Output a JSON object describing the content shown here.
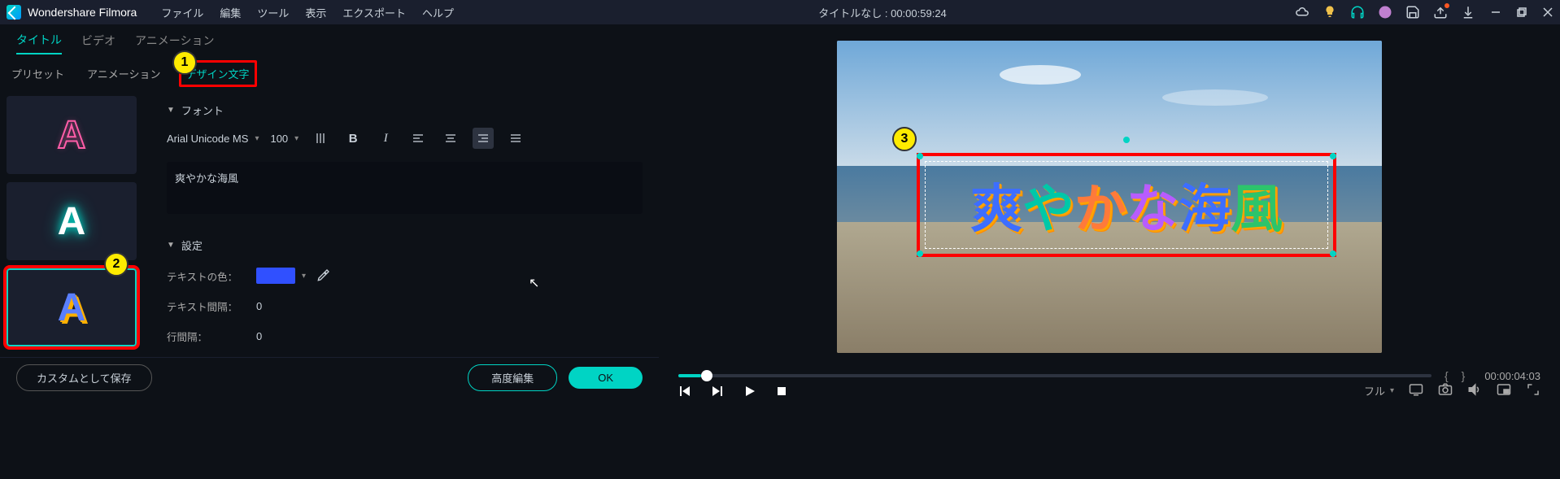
{
  "app": {
    "name": "Wondershare Filmora"
  },
  "menus": [
    "ファイル",
    "編集",
    "ツール",
    "表示",
    "エクスポート",
    "ヘルプ"
  ],
  "project_title": "タイトルなし : 00:00:59:24",
  "upper_tabs": {
    "items": [
      "タイトル",
      "ビデオ",
      "アニメーション"
    ],
    "active": 0
  },
  "lower_tabs": {
    "items": [
      "プリセット",
      "アニメーション",
      "デザイン文字"
    ],
    "active": 2
  },
  "font_section": {
    "label": "フォント",
    "family": "Arial Unicode MS",
    "size": "100"
  },
  "text_value": "爽やかな海風",
  "settings_section": {
    "label": "設定"
  },
  "settings": {
    "text_color_label": "テキストの色：",
    "text_color": "#3050ff",
    "spacing_label": "テキスト間隔：",
    "spacing_value": "0",
    "line_spacing_label": "行間隔：",
    "line_spacing_value": "0"
  },
  "buttons": {
    "save_custom": "カスタムとして保存",
    "advanced": "高度編集",
    "ok": "OK"
  },
  "preview_text_chars": [
    {
      "c": "爽",
      "color": "#3d6eff"
    },
    {
      "c": "や",
      "color": "#00c8a8"
    },
    {
      "c": "か",
      "color": "#ff7a3a"
    },
    {
      "c": "な",
      "color": "#b85cff"
    },
    {
      "c": "海",
      "color": "#3d6eff"
    },
    {
      "c": "風",
      "color": "#2dc46b"
    }
  ],
  "player": {
    "timecode": "00:00:04:03",
    "quality": "フル"
  },
  "badges": {
    "b1": "1",
    "b2": "2",
    "b3": "3"
  }
}
